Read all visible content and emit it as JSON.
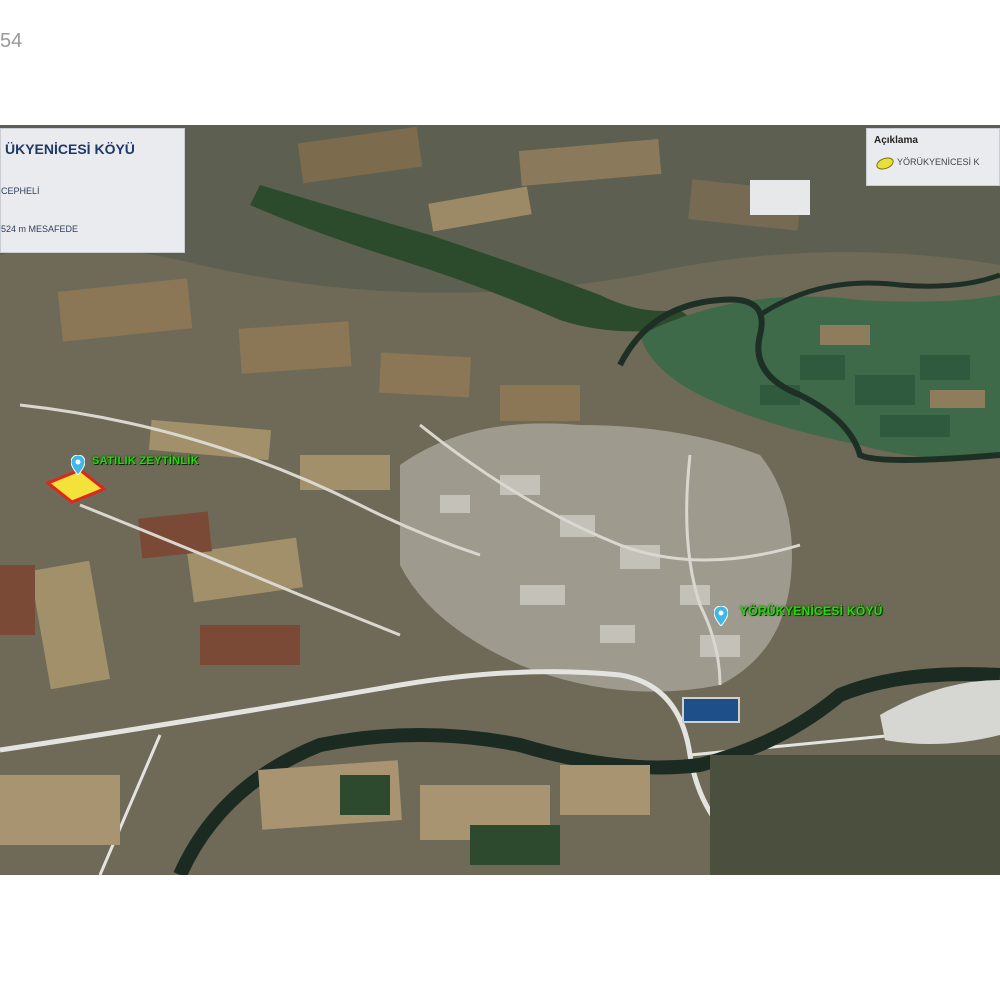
{
  "page": {
    "top_label": "54"
  },
  "info_panel": {
    "title": "ÜKYENİCESİ KÖYÜ",
    "lines": [
      "CEPHELİ",
      "524 m MESAFEDE"
    ]
  },
  "legend": {
    "title": "Açıklama",
    "items": [
      {
        "label": "YÖRÜKYENİCESİ K",
        "swatch_color": "#e8e03a"
      }
    ]
  },
  "markers": [
    {
      "name": "parcel",
      "label": "SATILIK ZEYTİNLİK",
      "pin_color": "#3fb8e8"
    },
    {
      "name": "village",
      "label": "YÖRÜKYENİCESİ KÖYÜ",
      "pin_color": "#3fb8e8"
    }
  ],
  "colors": {
    "parcel_fill": "#f2e23a",
    "parcel_outline": "#e0261a",
    "label_text": "#22e000"
  }
}
